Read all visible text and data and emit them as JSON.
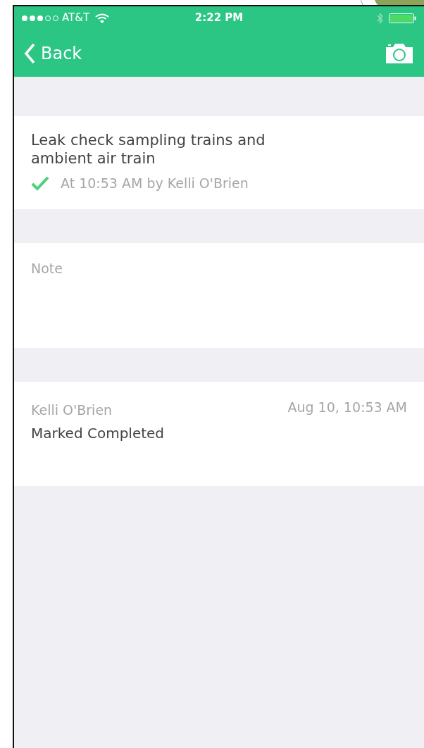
{
  "status_bar": {
    "carrier": "AT&T",
    "time": "2:22 PM"
  },
  "nav": {
    "back_label": "Back"
  },
  "task": {
    "title": "Leak check sampling trains and ambient air train",
    "completed": true,
    "completed_info": "At 10:53 AM by Kelli O'Brien"
  },
  "note": {
    "placeholder": "Note"
  },
  "activity": [
    {
      "author": "Kelli O'Brien",
      "timestamp": "Aug 10, 10:53 AM",
      "action": "Marked Completed"
    }
  ]
}
